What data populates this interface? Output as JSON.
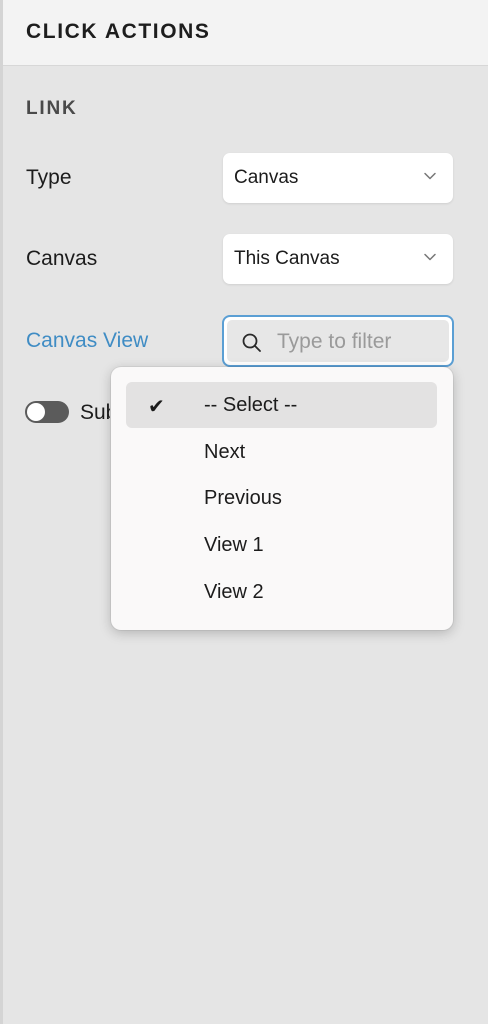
{
  "panel": {
    "title": "CLICK ACTIONS"
  },
  "link_section": {
    "title": "LINK",
    "type_field": {
      "label": "Type",
      "value": "Canvas"
    },
    "canvas_field": {
      "label": "Canvas",
      "value": "This Canvas"
    },
    "canvas_view_field": {
      "label": "Canvas View",
      "filter_placeholder": "Type to filter"
    },
    "toggle": {
      "label": "Sub",
      "on": false
    }
  },
  "dropdown": {
    "selected_check": "✔",
    "options": [
      {
        "label": "-- Select --",
        "selected": true
      },
      {
        "label": "Next",
        "selected": false
      },
      {
        "label": "Previous",
        "selected": false
      },
      {
        "label": "View 1",
        "selected": false
      },
      {
        "label": "View 2",
        "selected": false
      }
    ]
  },
  "colors": {
    "active_label": "#3f8cc4",
    "focus_border": "#5b9fd4",
    "panel_bg": "#e5e5e5",
    "header_bg": "#f3f3f3"
  }
}
